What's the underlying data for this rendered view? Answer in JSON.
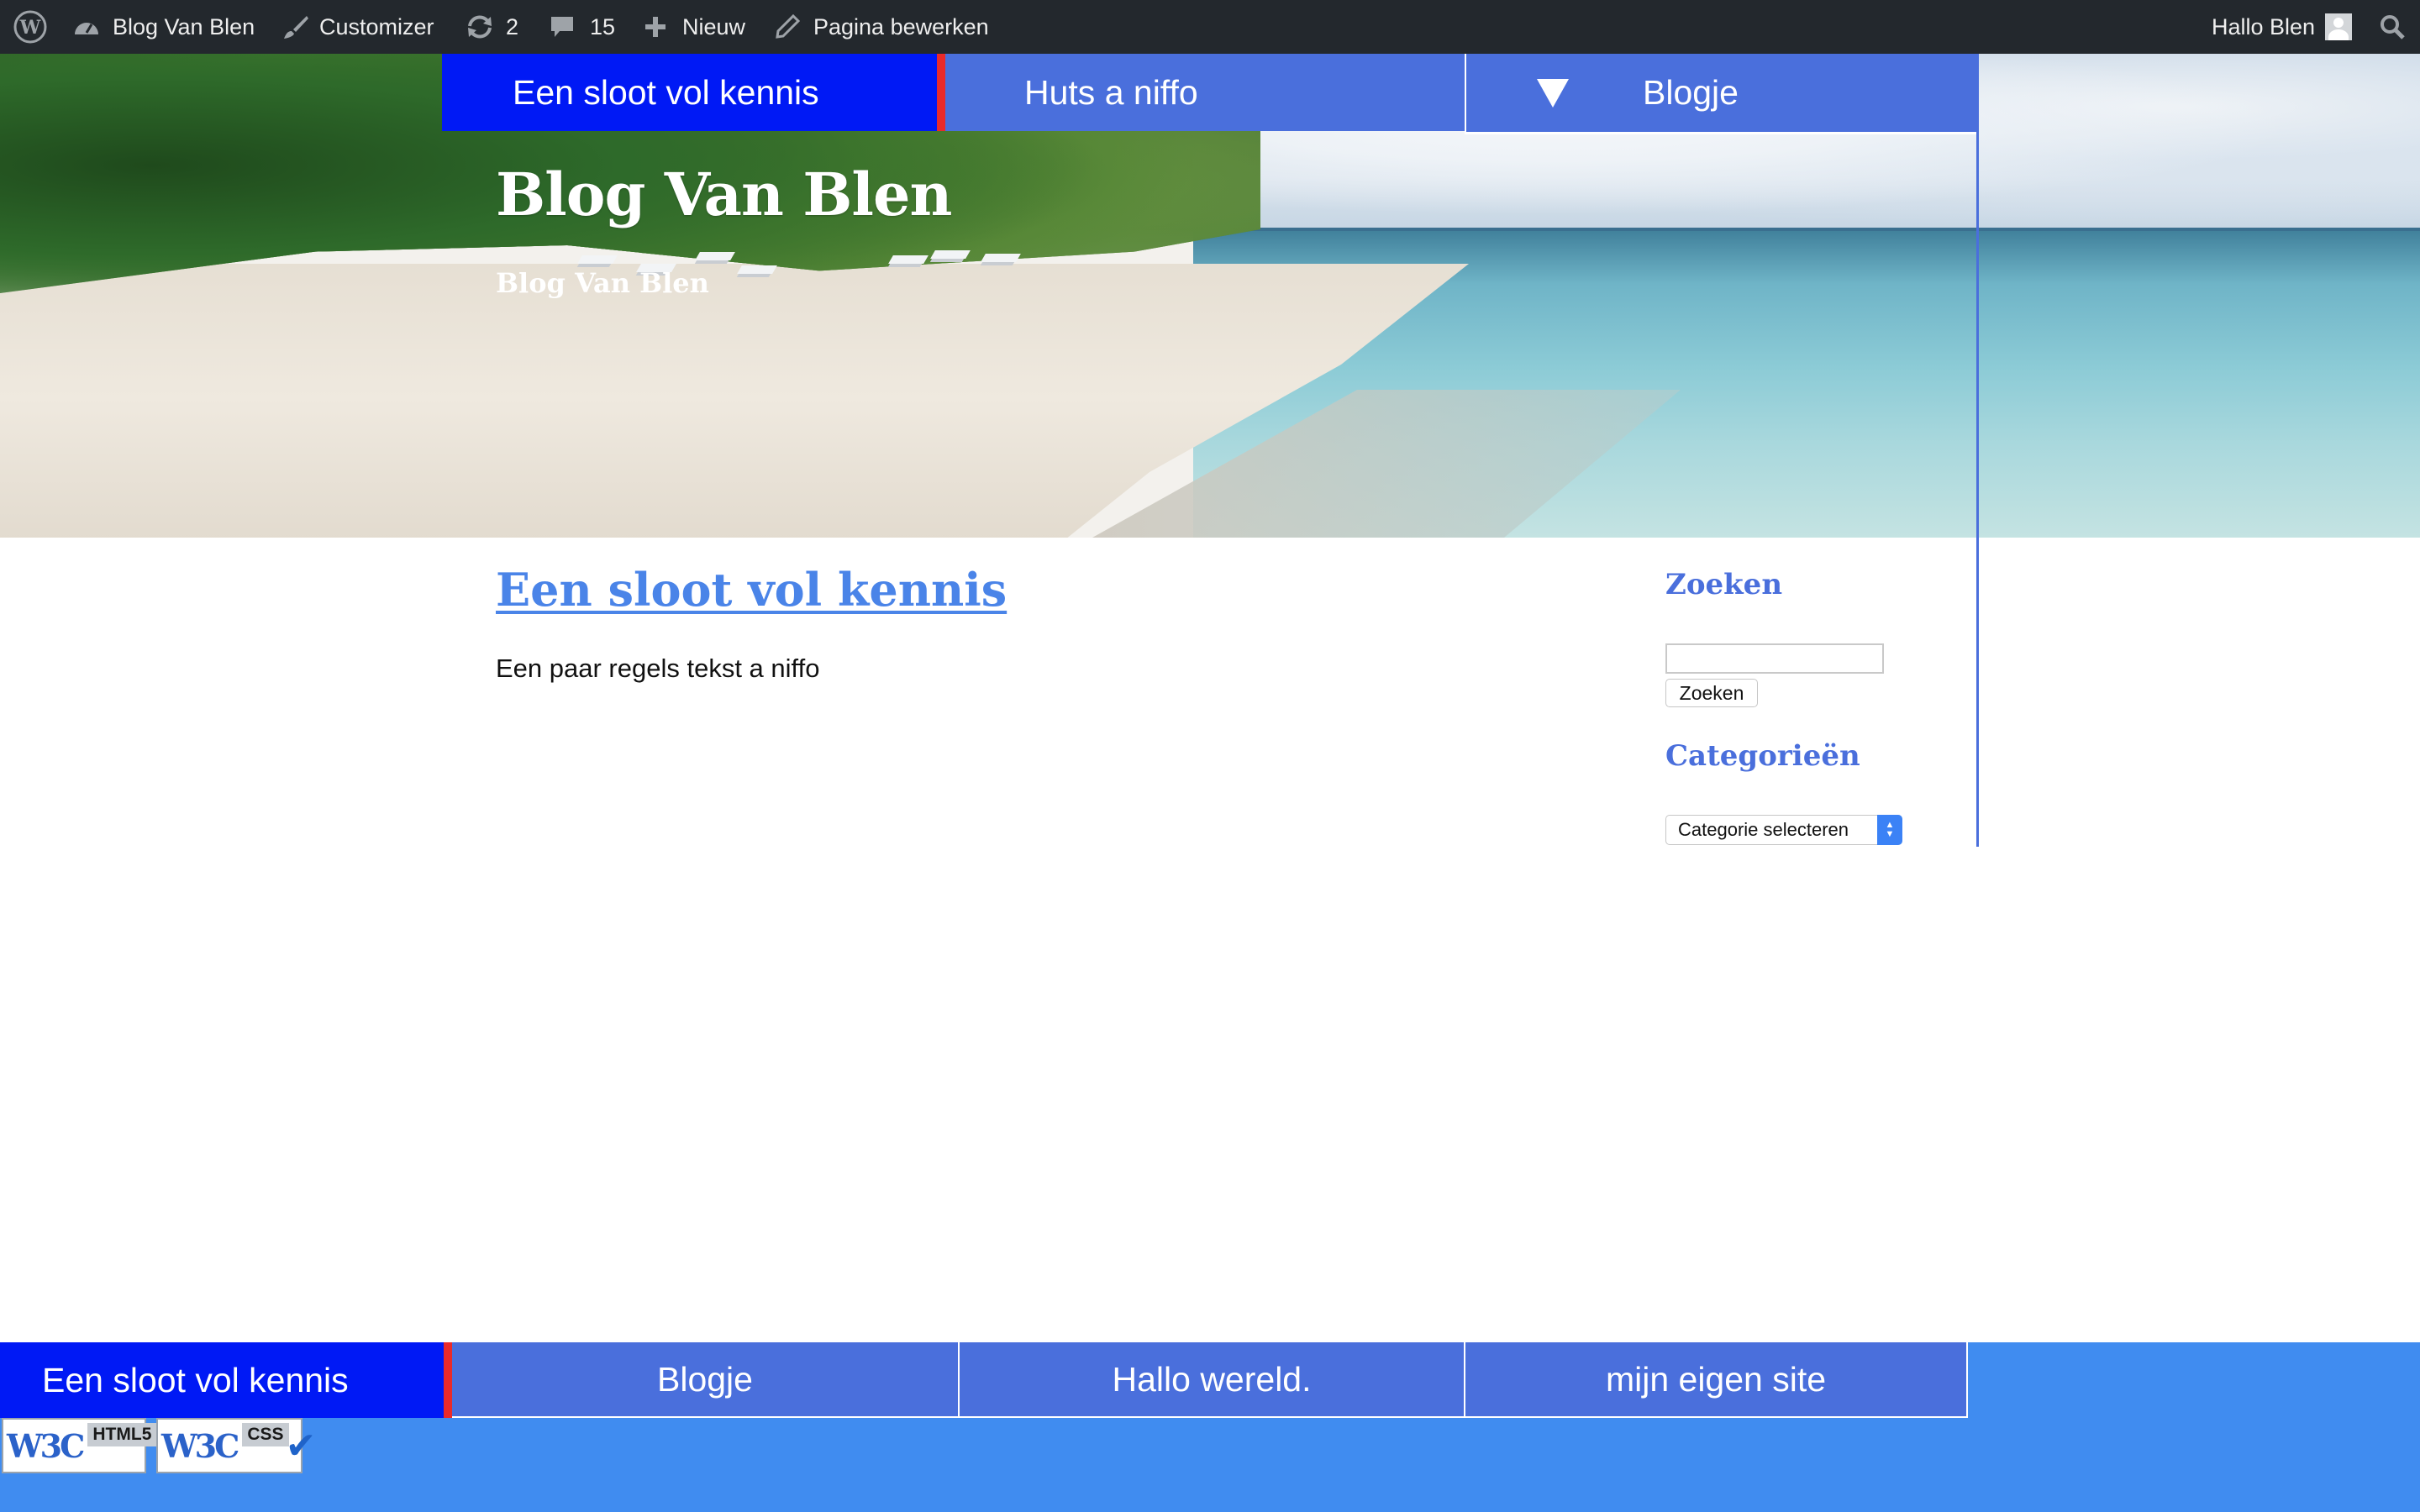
{
  "admin_bar": {
    "site_name": "Blog Van Blen",
    "customizer": "Customizer",
    "updates_count": "2",
    "comments_count": "15",
    "new": "Nieuw",
    "edit_page": "Pagina bewerken",
    "greeting": "Hallo Blen",
    "icons": [
      "wordpress-icon",
      "dashboard-icon",
      "brush-icon",
      "updates-icon",
      "comments-icon",
      "plus-icon",
      "pencil-icon",
      "avatar-icon",
      "search-icon"
    ]
  },
  "header": {
    "site_title": "Blog Van Blen",
    "site_description": "Blog Van Blen"
  },
  "top_nav": {
    "items": [
      {
        "label": "Een sloot vol kennis",
        "active": true
      },
      {
        "label": "Huts a niffo",
        "active": false
      },
      {
        "label": "Blogje",
        "active": false,
        "has_submenu": true
      }
    ]
  },
  "post": {
    "title": "Een sloot vol kennis",
    "excerpt": "Een paar regels tekst a niffo"
  },
  "sidebar": {
    "search_title": "Zoeken",
    "search_input_value": "",
    "search_button": "Zoeken",
    "categories_title": "Categorieën",
    "categories_select": "Categorie selecteren"
  },
  "footer_nav": {
    "items": [
      {
        "label": "Een sloot vol kennis",
        "active": true
      },
      {
        "label": "Blogje",
        "active": false
      },
      {
        "label": "Hallo wereld.",
        "active": false
      },
      {
        "label": "mijn eigen site",
        "active": false
      }
    ]
  },
  "badges": [
    {
      "label": "HTML5"
    },
    {
      "label": "CSS"
    }
  ],
  "colors": {
    "admin_bar_bg": "#23282d",
    "nav_blue": "#4a6fdc",
    "nav_active": "#0019f5",
    "nav_active_marker": "#ea2a2a",
    "link_blue": "#4a84e8",
    "footer_bg": "#408cf0"
  }
}
